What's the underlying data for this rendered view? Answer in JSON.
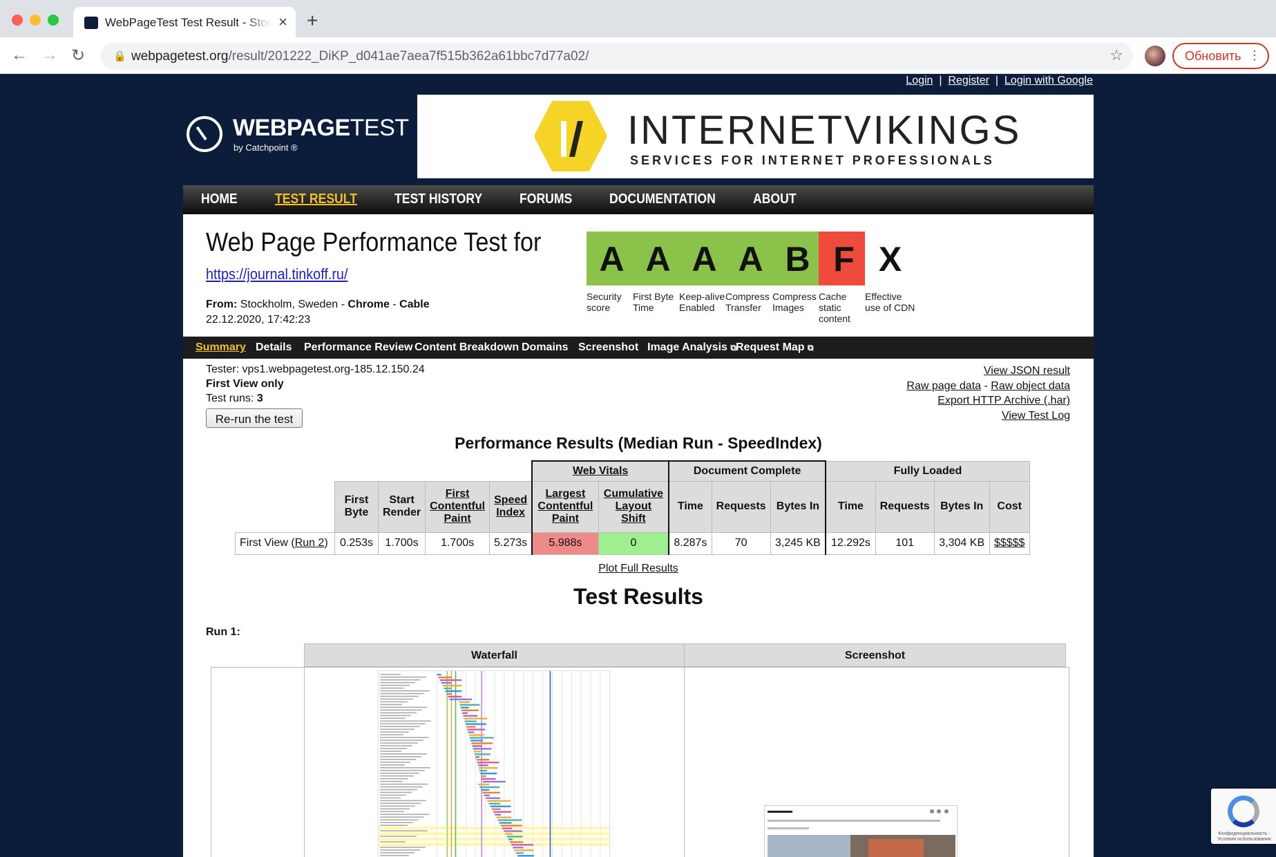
{
  "browser": {
    "tab_title": "WebPageTest Test Result - Stockholm",
    "url_host": "webpagetest.org",
    "url_path": "/result/201222_DiKP_d041ae7aea7f515b362a61bbc7d77a02/",
    "update_label": "Обновить"
  },
  "auth_links": {
    "login": "Login",
    "register": "Register",
    "login_google": "Login with Google"
  },
  "logo": {
    "text_bold": "WEBPAGE",
    "text_light": "TEST",
    "sub": "by Catchpoint ®"
  },
  "ad": {
    "title": "INTERNETVIKINGS",
    "subtitle": "SERVICES FOR INTERNET PROFESSIONALS"
  },
  "main_nav": [
    "HOME",
    "TEST RESULT",
    "TEST HISTORY",
    "FORUMS",
    "DOCUMENTATION",
    "ABOUT"
  ],
  "page": {
    "title": "Web Page Performance Test for",
    "tested_url": "https://journal.tinkoff.ru/",
    "from_label": "From:",
    "from_location": "Stockholm, Sweden",
    "browser": "Chrome",
    "connection": "Cable",
    "datetime": "22.12.2020, 17:42:23"
  },
  "grades": [
    {
      "letter": "A",
      "label": "Security score",
      "color": "#8bc34a"
    },
    {
      "letter": "A",
      "label": "First Byte Time",
      "color": "#8bc34a"
    },
    {
      "letter": "A",
      "label": "Keep-alive Enabled",
      "color": "#8bc34a"
    },
    {
      "letter": "A",
      "label": "Compress Transfer",
      "color": "#8bc34a"
    },
    {
      "letter": "B",
      "label": "Compress Images",
      "color": "#8bc34a"
    },
    {
      "letter": "F",
      "label": "Cache static content",
      "color": "#ef4b3d"
    },
    {
      "letter": "X",
      "label": "Effective use of CDN",
      "color": "#ffffff"
    }
  ],
  "sub_nav": [
    "Summary",
    "Details",
    "Performance Review",
    "Content Breakdown",
    "Domains",
    "Screenshot",
    "Image Analysis",
    "Request Map"
  ],
  "test_info": {
    "tester": "Tester: vps1.webpagetest.org-185.12.150.24",
    "view": "First View only",
    "runs_label": "Test runs:",
    "runs_value": "3",
    "rerun_button": "Re-run the test"
  },
  "result_links": {
    "json": "View JSON result",
    "raw_page": "Raw page data",
    "raw_object": "Raw object data",
    "har": "Export HTTP Archive (.har)",
    "log": "View Test Log"
  },
  "performance": {
    "title": "Performance Results (Median Run - SpeedIndex)",
    "group_headers": {
      "web_vitals": "Web Vitals",
      "doc_complete": "Document Complete",
      "fully_loaded": "Fully Loaded"
    },
    "columns": {
      "first_byte": "First Byte",
      "start_render": "Start Render",
      "fcp": "First Contentful Paint",
      "speed_index": "Speed Index",
      "lcp": "Largest Contentful Paint",
      "cls": "Cumulative Layout Shift",
      "time": "Time",
      "requests": "Requests",
      "bytes_in": "Bytes In",
      "cost": "Cost"
    },
    "row": {
      "label_prefix": "First View (",
      "label_link": "Run 2",
      "label_suffix": ")",
      "first_byte": "0.253s",
      "start_render": "1.700s",
      "fcp": "1.700s",
      "speed_index": "5.273s",
      "lcp": "5.988s",
      "cls": "0",
      "doc_time": "8.287s",
      "doc_requests": "70",
      "doc_bytes": "3,245 KB",
      "full_time": "12.292s",
      "full_requests": "101",
      "full_bytes": "3,304 KB",
      "cost": "$$$$$"
    },
    "colors": {
      "lcp_bg": "#f08a8a",
      "cls_bg": "#9ef08e"
    },
    "plot_link": "Plot Full Results"
  },
  "test_results": {
    "title": "Test Results",
    "run_label": "Run 1:",
    "waterfall_header": "Waterfall",
    "screenshot_header": "Screenshot"
  },
  "recaptcha": {
    "text": "Конфиденциальность - Условия использования"
  }
}
